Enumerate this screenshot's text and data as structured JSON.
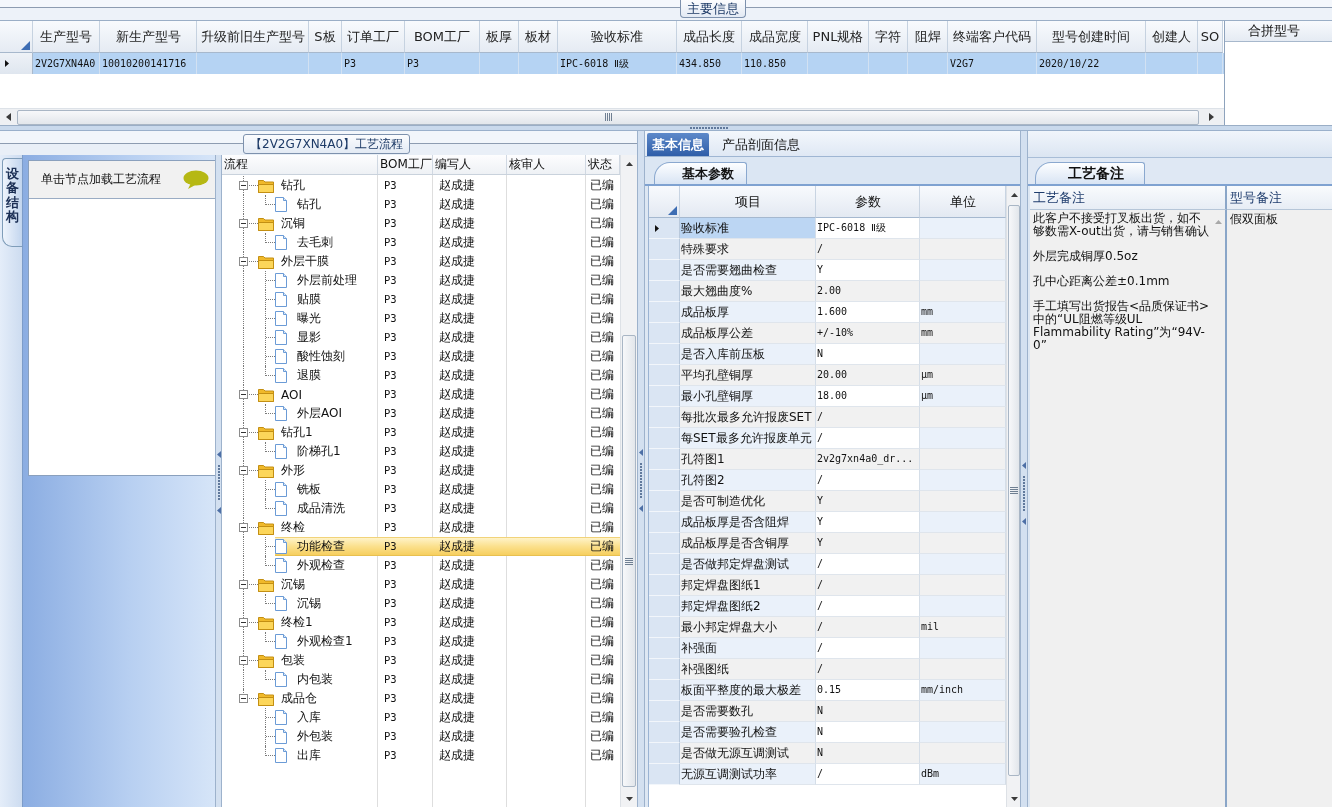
{
  "main_info": {
    "title": "主要信息",
    "columns": [
      "生产型号",
      "新生产型号",
      "升级前旧生产型号",
      "S板",
      "订单工厂",
      "BOM工厂",
      "板厚",
      "板材",
      "验收标准",
      "成品长度",
      "成品宽度",
      "PNL规格",
      "字符",
      "阻焊",
      "终端客户代码",
      "型号创建时间",
      "创建人",
      "SO"
    ],
    "rows": [
      {
        "selected": true,
        "cells": [
          "2V2G7XN4A0",
          "10010200141716",
          null,
          null,
          "P3",
          "P3",
          null,
          null,
          "IPC-6018 Ⅱ级",
          "434.850",
          "110.850",
          null,
          null,
          null,
          "V2G7",
          "2020/10/22",
          null,
          null
        ]
      }
    ]
  },
  "merge_panel": {
    "columns": [
      "合拼型号"
    ]
  },
  "process_panel": {
    "title": "【2V2G7XN4A0】工艺流程",
    "side_tab": "设备结构",
    "hint": "单击节点加载工艺流程",
    "columns": [
      "流程",
      "BOM工厂",
      "编写人",
      "核审人",
      "状态"
    ],
    "tree": [
      {
        "name": "钻孔",
        "bom": "P3",
        "writer": "赵成捷",
        "status": "已编",
        "expanded": true,
        "selected": false,
        "children": [
          {
            "name": "钻孔",
            "bom": "P3",
            "writer": "赵成捷",
            "status": "已编",
            "selected": false
          }
        ]
      },
      {
        "name": "沉铜",
        "bom": "P3",
        "writer": "赵成捷",
        "status": "已编",
        "expanded": true,
        "selected": false,
        "children": [
          {
            "name": "去毛刺",
            "bom": "P3",
            "writer": "赵成捷",
            "status": "已编",
            "selected": false
          }
        ]
      },
      {
        "name": "外层干膜",
        "bom": "P3",
        "writer": "赵成捷",
        "status": "已编",
        "expanded": true,
        "selected": false,
        "children": [
          {
            "name": "外层前处理",
            "bom": "P3",
            "writer": "赵成捷",
            "status": "已编",
            "selected": false
          },
          {
            "name": "贴膜",
            "bom": "P3",
            "writer": "赵成捷",
            "status": "已编",
            "selected": false
          },
          {
            "name": "曝光",
            "bom": "P3",
            "writer": "赵成捷",
            "status": "已编",
            "selected": false
          },
          {
            "name": "显影",
            "bom": "P3",
            "writer": "赵成捷",
            "status": "已编",
            "selected": false
          },
          {
            "name": "酸性蚀刻",
            "bom": "P3",
            "writer": "赵成捷",
            "status": "已编",
            "selected": false
          },
          {
            "name": "退膜",
            "bom": "P3",
            "writer": "赵成捷",
            "status": "已编",
            "selected": false
          }
        ]
      },
      {
        "name": "AOI",
        "bom": "P3",
        "writer": "赵成捷",
        "status": "已编",
        "expanded": true,
        "selected": false,
        "children": [
          {
            "name": "外层AOI",
            "bom": "P3",
            "writer": "赵成捷",
            "status": "已编",
            "selected": false
          }
        ]
      },
      {
        "name": "钻孔1",
        "bom": "P3",
        "writer": "赵成捷",
        "status": "已编",
        "expanded": true,
        "selected": false,
        "children": [
          {
            "name": "阶梯孔1",
            "bom": "P3",
            "writer": "赵成捷",
            "status": "已编",
            "selected": false
          }
        ]
      },
      {
        "name": "外形",
        "bom": "P3",
        "writer": "赵成捷",
        "status": "已编",
        "expanded": true,
        "selected": false,
        "children": [
          {
            "name": "铣板",
            "bom": "P3",
            "writer": "赵成捷",
            "status": "已编",
            "selected": false
          },
          {
            "name": "成品清洗",
            "bom": "P3",
            "writer": "赵成捷",
            "status": "已编",
            "selected": false
          }
        ]
      },
      {
        "name": "终检",
        "bom": "P3",
        "writer": "赵成捷",
        "status": "已编",
        "expanded": true,
        "selected": false,
        "children": [
          {
            "name": "功能检查",
            "bom": "P3",
            "writer": "赵成捷",
            "status": "已编",
            "selected": true
          },
          {
            "name": "外观检查",
            "bom": "P3",
            "writer": "赵成捷",
            "status": "已编",
            "selected": false
          }
        ]
      },
      {
        "name": "沉锡",
        "bom": "P3",
        "writer": "赵成捷",
        "status": "已编",
        "expanded": true,
        "selected": false,
        "children": [
          {
            "name": "沉锡",
            "bom": "P3",
            "writer": "赵成捷",
            "status": "已编",
            "selected": false
          }
        ]
      },
      {
        "name": "终检1",
        "bom": "P3",
        "writer": "赵成捷",
        "status": "已编",
        "expanded": true,
        "selected": false,
        "children": [
          {
            "name": "外观检查1",
            "bom": "P3",
            "writer": "赵成捷",
            "status": "已编",
            "selected": false
          }
        ]
      },
      {
        "name": "包装",
        "bom": "P3",
        "writer": "赵成捷",
        "status": "已编",
        "expanded": true,
        "selected": false,
        "children": [
          {
            "name": "内包装",
            "bom": "P3",
            "writer": "赵成捷",
            "status": "已编",
            "selected": false
          }
        ]
      },
      {
        "name": "成品仓",
        "bom": "P3",
        "writer": "赵成捷",
        "status": "已编",
        "expanded": true,
        "selected": false,
        "children": [
          {
            "name": "入库",
            "bom": "P3",
            "writer": "赵成捷",
            "status": "已编",
            "selected": false
          },
          {
            "name": "外包装",
            "bom": "P3",
            "writer": "赵成捷",
            "status": "已编",
            "selected": false
          },
          {
            "name": "出库",
            "bom": "P3",
            "writer": "赵成捷",
            "status": "已编",
            "selected": false
          }
        ]
      }
    ]
  },
  "detail_tabs": [
    {
      "label": "基本信息",
      "selected": true
    },
    {
      "label": "产品剖面信息",
      "selected": false
    }
  ],
  "basic_params": {
    "tab": "基本参数",
    "columns": [
      "项目",
      "参数",
      "单位"
    ],
    "rows": [
      {
        "item": "验收标准",
        "value": "IPC-6018 Ⅱ级",
        "selected": true
      },
      {
        "item": "特殊要求",
        "value": "/",
        "selected": false
      },
      {
        "item": "是否需要翘曲检查",
        "value": "Y",
        "selected": false
      },
      {
        "item": "最大翘曲度%",
        "value": "2.00",
        "selected": false
      },
      {
        "item": "成品板厚",
        "value": "1.600",
        "unit": "mm",
        "selected": false
      },
      {
        "item": "成品板厚公差",
        "value": "+/-10%",
        "unit": "mm",
        "selected": false
      },
      {
        "item": "是否入库前压板",
        "value": "N",
        "selected": false
      },
      {
        "item": "平均孔壁铜厚",
        "value": "20.00",
        "unit": "μm",
        "selected": false
      },
      {
        "item": "最小孔壁铜厚",
        "value": "18.00",
        "unit": "μm",
        "selected": false
      },
      {
        "item": "每批次最多允许报废SET",
        "value": "/",
        "selected": false
      },
      {
        "item": "每SET最多允许报废单元",
        "value": "/",
        "selected": false
      },
      {
        "item": "孔符图1",
        "value": "2v2g7xn4a0_dr...",
        "selected": false
      },
      {
        "item": "孔符图2",
        "value": "/",
        "selected": false
      },
      {
        "item": "是否可制造优化",
        "value": "Y",
        "selected": false
      },
      {
        "item": "成品板厚是否含阻焊",
        "value": "Y",
        "selected": false
      },
      {
        "item": "成品板厚是否含铜厚",
        "value": "Y",
        "selected": false
      },
      {
        "item": "是否做邦定焊盘测试",
        "value": "/",
        "selected": false
      },
      {
        "item": "邦定焊盘图纸1",
        "value": "/",
        "selected": false
      },
      {
        "item": "邦定焊盘图纸2",
        "value": "/",
        "selected": false
      },
      {
        "item": "最小邦定焊盘大小",
        "value": "/",
        "unit": "mil",
        "selected": false
      },
      {
        "item": "补强面",
        "value": "/",
        "selected": false
      },
      {
        "item": "补强图纸",
        "value": "/",
        "selected": false
      },
      {
        "item": "板面平整度的最大极差",
        "value": "0.15",
        "unit": "mm/inch",
        "selected": false
      },
      {
        "item": "是否需要数孔",
        "value": "N",
        "selected": false
      },
      {
        "item": "是否需要验孔检查",
        "value": "N",
        "selected": false
      },
      {
        "item": "是否做无源互调测试",
        "value": "N",
        "selected": false
      },
      {
        "item": "无源互调测试功率",
        "value": "/",
        "unit": "dBm",
        "selected": false
      }
    ]
  },
  "process_notes": {
    "tab": "工艺备注",
    "columns": [
      "工艺备注",
      "型号备注"
    ],
    "process_note": [
      "此客户不接受打叉板出货，如不够数需X-out出货，请与销售确认",
      "外层完成铜厚0.5oz",
      "孔中心距离公差±0.1mm",
      "手工填写出货报告<品质保证书>中的“UL阻燃等级UL Flammability Rating”为“94V-0”"
    ],
    "model_note": "假双面板"
  }
}
